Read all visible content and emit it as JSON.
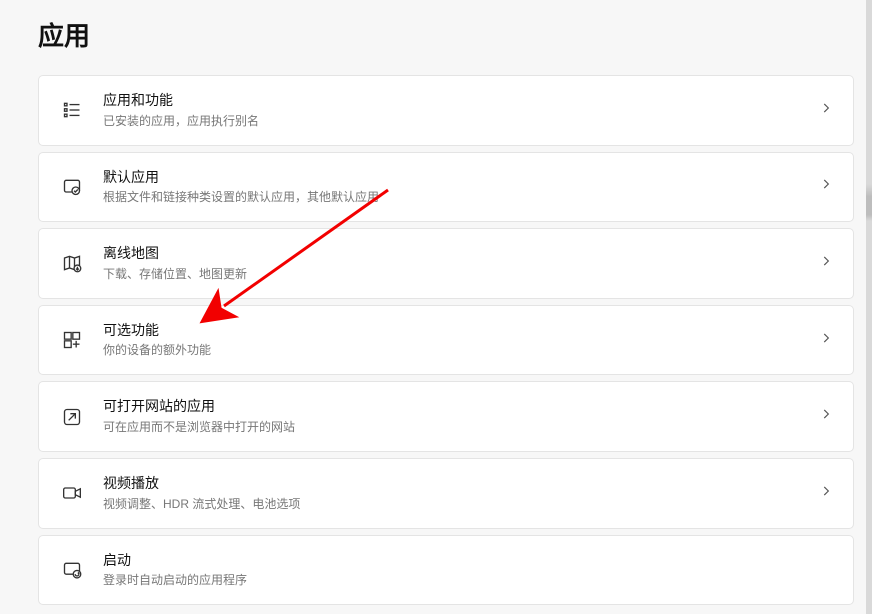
{
  "page": {
    "title": "应用"
  },
  "items": [
    {
      "icon": "list-details",
      "title": "应用和功能",
      "subtitle": "已安装的应用，应用执行别名"
    },
    {
      "icon": "default-app",
      "title": "默认应用",
      "subtitle": "根据文件和链接种类设置的默认应用，其他默认应用"
    },
    {
      "icon": "map-download",
      "title": "离线地图",
      "subtitle": "下载、存储位置、地图更新"
    },
    {
      "icon": "apps-add",
      "title": "可选功能",
      "subtitle": "你的设备的额外功能"
    },
    {
      "icon": "external-link",
      "title": "可打开网站的应用",
      "subtitle": "可在应用而不是浏览器中打开的网站"
    },
    {
      "icon": "video",
      "title": "视频播放",
      "subtitle": "视频调整、HDR 流式处理、电池选项"
    },
    {
      "icon": "startup",
      "title": "启动",
      "subtitle": "登录时自动启动的应用程序"
    }
  ]
}
